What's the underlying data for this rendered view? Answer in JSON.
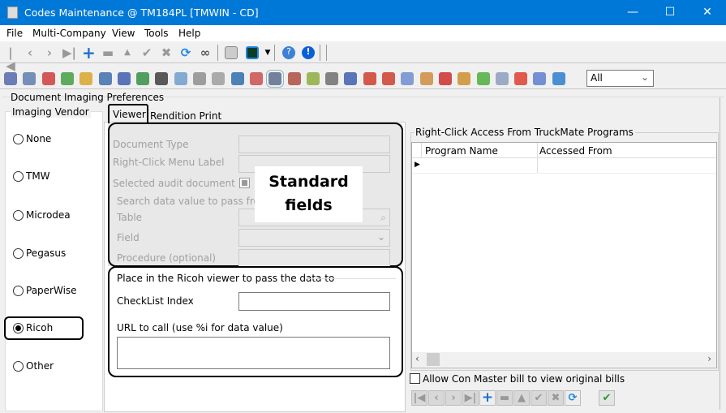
{
  "window": {
    "title": "Codes Maintenance @ TM184PL [TMWIN - CD]",
    "minimize": "—",
    "maximize": "☐",
    "close": "✕"
  },
  "menu": [
    "File",
    "Multi-Company",
    "View",
    "Tools",
    "Help"
  ],
  "toolbar1": {
    "icons": [
      "first-icon",
      "prev-icon",
      "next-icon",
      "last-icon",
      "add-icon",
      "delete-icon",
      "up-icon",
      "post-icon",
      "cancel-icon",
      "refresh-icon",
      "find-icon",
      "print-icon",
      "monitor-icon",
      "help-icon",
      "info-icon"
    ]
  },
  "toolbar2": {
    "icon_colors": [
      "#4a5fa8",
      "#5577aa",
      "#cc3333",
      "#3a9a3a",
      "#d9a020",
      "#3366aa",
      "#3355aa",
      "#2a8a3a",
      "#333333",
      "#6699cc",
      "#888888",
      "#999999",
      "#2266aa",
      "#cc4444",
      "#556688",
      "#aa4433",
      "#88aa33",
      "#666666",
      "#3355aa",
      "#cc3322",
      "#cc3322",
      "#6688cc",
      "#cc8833",
      "#cc2222",
      "#cc8822",
      "#44aa33",
      "#8899bb",
      "#dd3322",
      "#5577cc",
      "#2277cc"
    ],
    "filter_value": "All"
  },
  "main": {
    "group_title": "Document Imaging Preferences",
    "vendor": {
      "title": "Imaging Vendor",
      "options": [
        "None",
        "TMW",
        "Microdea",
        "Pegasus",
        "PaperWise",
        "Ricoh",
        "Other"
      ],
      "selected": "Ricoh"
    },
    "tabs": [
      "Viewer",
      "Rendition Print"
    ],
    "active_tab": "Viewer",
    "standard": {
      "document_type": "Document Type",
      "menu_label": "Right-Click Menu Label",
      "audit_doc": "Selected audit document",
      "search_caption": "Search data value to pass from T",
      "table": "Table",
      "field": "Field",
      "procedure": "Procedure (optional)"
    },
    "annotation": "Standard\nfields",
    "ricoh": {
      "caption": "Place in the Ricoh viewer to pass the data to",
      "checklist_index": "CheckList Index",
      "url_label": "URL to call (use %i for data value)"
    },
    "right_click": {
      "title": "Right-Click Access From TruckMate Programs",
      "columns": [
        "Program Name",
        "Accessed From"
      ]
    },
    "allow_con_master": {
      "label": "Allow Con Master bill to view original bills",
      "checked": false
    }
  }
}
